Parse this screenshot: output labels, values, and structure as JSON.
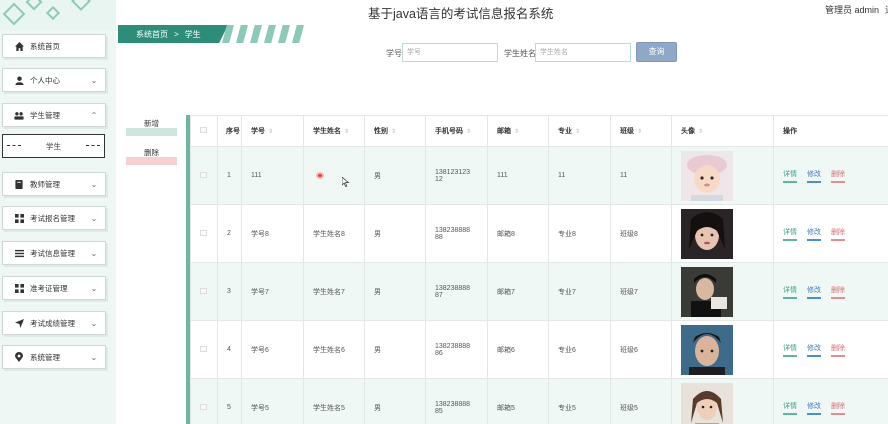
{
  "header": {
    "title": "基于java语言的考试信息报名系统",
    "user": "管理员 admin",
    "logout_partial": "退"
  },
  "breadcrumb": {
    "home": "系统首页",
    "sep": ">",
    "current": "学生"
  },
  "search": {
    "xuehao_label": "学号",
    "xuehao_placeholder": "学号",
    "name_label": "学生姓名",
    "name_placeholder": "学生姓名",
    "button": "查询"
  },
  "sidebar": {
    "items": [
      {
        "label": "系统首页",
        "icon": "home-icon",
        "chevron": ""
      },
      {
        "label": "个人中心",
        "icon": "user-icon",
        "chevron": "⌄"
      },
      {
        "label": "学生管理",
        "icon": "students-icon",
        "chevron": "⌃"
      },
      {
        "label": "教师管理",
        "icon": "teacher-icon",
        "chevron": "⌄"
      },
      {
        "label": "考试报名管理",
        "icon": "grid-icon",
        "chevron": "⌄"
      },
      {
        "label": "考试信息管理",
        "icon": "list-icon",
        "chevron": "⌄"
      },
      {
        "label": "准考证管理",
        "icon": "grid-icon",
        "chevron": "⌄"
      },
      {
        "label": "考试成绩管理",
        "icon": "send-icon",
        "chevron": "⌄"
      },
      {
        "label": "系统管理",
        "icon": "location-icon",
        "chevron": "⌄"
      }
    ],
    "sub_item": "学生"
  },
  "actions": {
    "add": "新增",
    "delete": "删除"
  },
  "table": {
    "headers": [
      "",
      "序号",
      "学号",
      "学生姓名",
      "性别",
      "手机号码",
      "邮箱",
      "专业",
      "班级",
      "头像",
      "操作"
    ],
    "rows": [
      {
        "no": "1",
        "xuehao": "111",
        "name": "",
        "gender": "男",
        "phone1": "138123123",
        "phone2": "12",
        "email": "111",
        "major": "11",
        "class": "11"
      },
      {
        "no": "2",
        "xuehao": "学号8",
        "name": "学生姓名8",
        "gender": "男",
        "phone1": "138238888",
        "phone2": "88",
        "email": "邮箱8",
        "major": "专业8",
        "class": "班级8"
      },
      {
        "no": "3",
        "xuehao": "学号7",
        "name": "学生姓名7",
        "gender": "男",
        "phone1": "138238888",
        "phone2": "87",
        "email": "邮箱7",
        "major": "专业7",
        "class": "班级7"
      },
      {
        "no": "4",
        "xuehao": "学号6",
        "name": "学生姓名6",
        "gender": "男",
        "phone1": "138238888",
        "phone2": "86",
        "email": "邮箱6",
        "major": "专业6",
        "class": "班级6"
      },
      {
        "no": "5",
        "xuehao": "学号5",
        "name": "学生姓名5",
        "gender": "男",
        "phone1": "138238888",
        "phone2": "85",
        "email": "邮箱5",
        "major": "专业5",
        "class": "班级5"
      }
    ],
    "ops": {
      "detail": "详情",
      "edit": "修改",
      "delete": "删除"
    }
  },
  "colors": {
    "accent": "#2e8d78",
    "sidebar_bg": "#eef7f4",
    "row_alt": "#f0f8f6"
  }
}
